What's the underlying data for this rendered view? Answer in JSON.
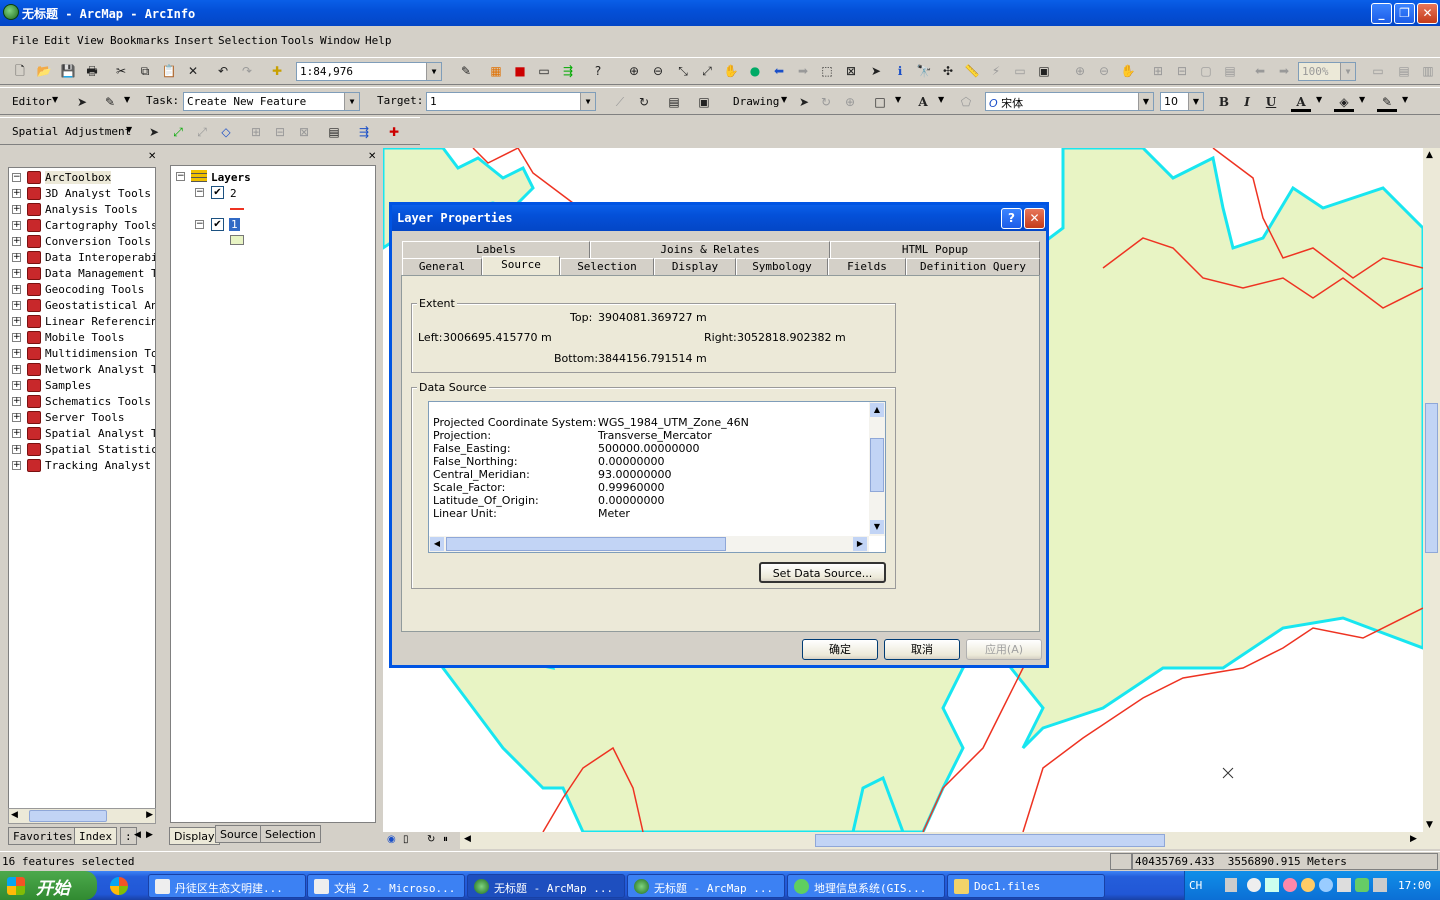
{
  "window": {
    "title": "无标题 - ArcMap - ArcInfo",
    "min": "_",
    "max": "❐",
    "close": "✕"
  },
  "menu": [
    "File",
    "Edit",
    "View",
    "Bookmarks",
    "Insert",
    "Selection",
    "Tools",
    "Window",
    "Help"
  ],
  "standard_toolbar": {
    "scale": "1:84,976",
    "zoom": "100%"
  },
  "editor_toolbar": {
    "editor_label": "Editor",
    "task_label": "Task:",
    "task_value": "Create New Feature",
    "target_label": "Target:",
    "target_value": "1",
    "drawing_label": "Drawing",
    "font_value": "宋体",
    "size_value": "10",
    "bold": "B",
    "italic": "I",
    "underline": "U",
    "text_a": "A"
  },
  "spatial_toolbar": {
    "label": "Spatial Adjustment"
  },
  "toolbox": {
    "title": "ArcToolbox",
    "items": [
      "3D Analyst Tools",
      "Analysis Tools",
      "Cartography Tools",
      "Conversion Tools",
      "Data Interoperabi",
      "Data Management T",
      "Geocoding Tools",
      "Geostatistical An",
      "Linear Referencin",
      "Mobile Tools",
      "Multidimension To",
      "Network Analyst T",
      "Samples",
      "Schematics Tools",
      "Server Tools",
      "Spatial Analyst T",
      "Spatial Statistic",
      "Tracking Analyst "
    ],
    "tabs": [
      "Favorites",
      "Index",
      ":"
    ]
  },
  "toc": {
    "root": "Layers",
    "layer1": "2",
    "layer2": "1",
    "tabs": [
      "Display",
      "Source",
      "Selection"
    ]
  },
  "dialog": {
    "title": "Layer Properties",
    "help": "?",
    "close": "✕",
    "tabs_top": [
      "Labels",
      "Joins & Relates",
      "HTML Popup"
    ],
    "tabs_bottom": [
      "General",
      "Source",
      "Selection",
      "Display",
      "Symbology",
      "Fields",
      "Definition Query"
    ],
    "extent": {
      "label": "Extent",
      "top_label": "Top:",
      "top": "3904081.369727 m",
      "left_label": "Left:",
      "left": "3006695.415770 m",
      "right_label": "Right:",
      "right": "3052818.902382 m",
      "bottom_label": "Bottom:",
      "bottom": "3844156.791514 m"
    },
    "data_source": {
      "label": "Data Source",
      "rows": [
        {
          "k": "Projected Coordinate System:",
          "v": "WGS_1984_UTM_Zone_46N"
        },
        {
          "k": "Projection:",
          "v": "Transverse_Mercator"
        },
        {
          "k": "False_Easting:",
          "v": "500000.00000000"
        },
        {
          "k": "False_Northing:",
          "v": "0.00000000"
        },
        {
          "k": "Central_Meridian:",
          "v": "93.00000000"
        },
        {
          "k": "Scale_Factor:",
          "v": "0.99960000"
        },
        {
          "k": "Latitude_Of_Origin:",
          "v": "0.00000000"
        },
        {
          "k": "Linear Unit:",
          "v": "Meter"
        }
      ],
      "set_button": "Set Data Source..."
    },
    "ok": "确定",
    "cancel": "取消",
    "apply": "应用(A)"
  },
  "status": {
    "left": "16 features selected",
    "coords": "40435769.433  3556890.915 Meters"
  },
  "taskbar": {
    "start": "开始",
    "tasks": [
      "丹徒区生态文明建...",
      "文档 2 - Microso...",
      "无标题 - ArcMap ...",
      "无标题 - ArcMap ...",
      "地理信息系统(GIS...",
      "Doc1.files"
    ],
    "lang": "CH",
    "time": "17:00"
  },
  "colors": {
    "map_fill": "#e8f4c4",
    "cyan": "#18e6f0",
    "red": "#ee3322",
    "title_blue": "#0450d8"
  }
}
